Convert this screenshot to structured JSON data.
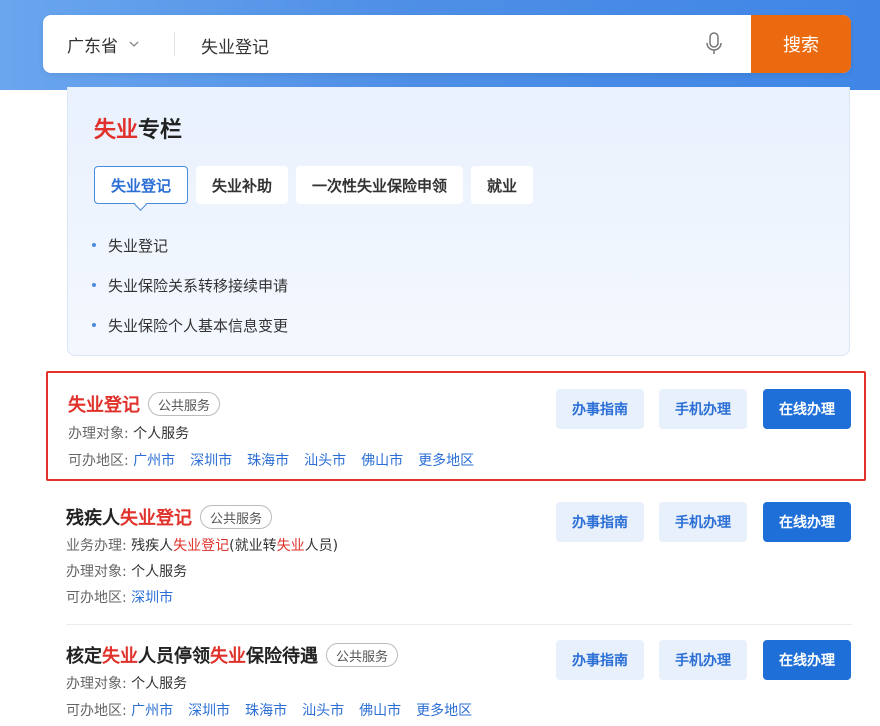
{
  "search": {
    "province": "广东省",
    "query": "失业登记",
    "button": "搜索"
  },
  "column": {
    "title_red": "失业",
    "title_rest": "专栏",
    "tabs": [
      "失业登记",
      "失业补助",
      "一次性失业保险申领",
      "就业"
    ],
    "items": [
      "失业登记",
      "失业保险关系转移接续申请",
      "失业保险个人基本信息变更"
    ]
  },
  "labels": {
    "badge": "公共服务",
    "target": "办理对象:",
    "region": "可办地区:",
    "business": "业务办理:",
    "guide": "办事指南",
    "mobile": "手机办理",
    "online": "在线办理"
  },
  "results": [
    {
      "title_red": "失业登记",
      "target": "个人服务",
      "regions": [
        "广州市",
        "深圳市",
        "珠海市",
        "汕头市",
        "佛山市",
        "更多地区"
      ]
    },
    {
      "title_pre": "残疾人",
      "title_red": "失业登记",
      "business_pre": "残疾人",
      "business_red1": "失业登记",
      "business_mid": "(就业转",
      "business_red2": "失业",
      "business_post": "人员)",
      "target": "个人服务",
      "regions": [
        "深圳市"
      ]
    },
    {
      "title_pre": "核定",
      "title_red1": "失业",
      "title_mid": "人员停领",
      "title_red2": "失业",
      "title_post": "保险待遇",
      "target": "个人服务",
      "regions": [
        "广州市",
        "深圳市",
        "珠海市",
        "汕头市",
        "佛山市",
        "更多地区"
      ]
    }
  ],
  "colors": {
    "accent": "#1f6fd8",
    "highlight": "#e0312b",
    "search_button": "#ec6a0f"
  }
}
